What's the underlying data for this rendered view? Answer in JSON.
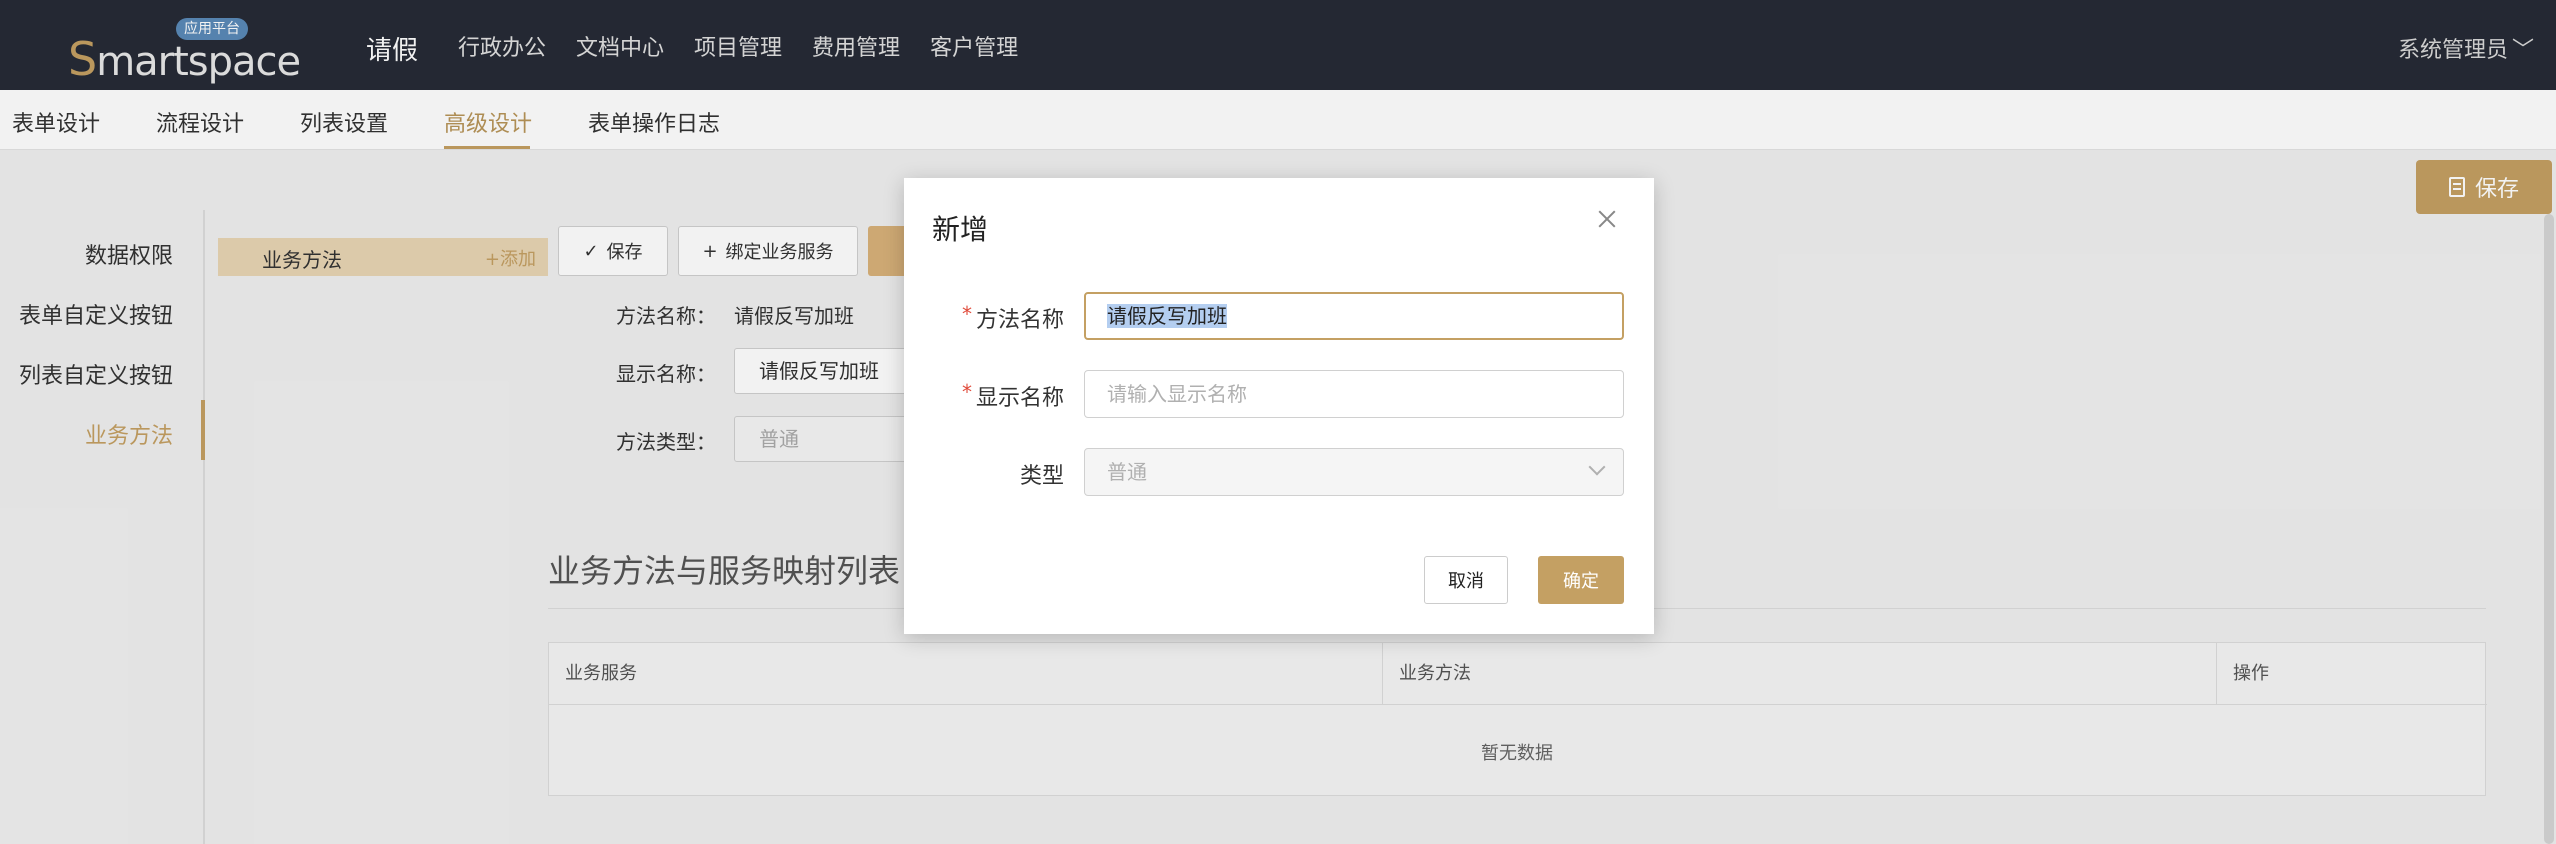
{
  "header": {
    "logo_text_s": "S",
    "logo_text_rest": "martspace",
    "logo_badge": "应用平台",
    "app_title": "请假",
    "nav": [
      "行政办公",
      "文档中心",
      "项目管理",
      "费用管理",
      "客户管理"
    ],
    "user": "系统管理员"
  },
  "tabs": [
    "表单设计",
    "流程设计",
    "列表设置",
    "高级设计",
    "表单操作日志"
  ],
  "active_tab": "高级设计",
  "save_button": "保存",
  "sidebar": {
    "items": [
      "数据权限",
      "表单自定义按钮",
      "列表自定义按钮",
      "业务方法"
    ],
    "active": "业务方法"
  },
  "method_list": {
    "item_name": "业务方法",
    "add_label": "+添加"
  },
  "toolbar": {
    "save_label": "保存",
    "bind_label": "绑定业务服务"
  },
  "form": {
    "method_name_label": "方法名称：",
    "method_name_value": "请假反写加班",
    "display_name_label": "显示名称：",
    "display_name_value": "请假反写加班",
    "method_type_label": "方法类型：",
    "method_type_value": "普通"
  },
  "section": {
    "title": "业务方法与服务映射列表",
    "columns": [
      "业务服务",
      "业务方法",
      "操作"
    ],
    "empty_text": "暂无数据"
  },
  "modal": {
    "title": "新增",
    "fields": [
      {
        "label": "方法名称",
        "required": true,
        "value": "请假反写加班",
        "placeholder": ""
      },
      {
        "label": "显示名称",
        "required": true,
        "value": "",
        "placeholder": "请输入显示名称"
      },
      {
        "label": "类型",
        "required": false,
        "value": "普通",
        "placeholder": ""
      }
    ],
    "required_mark": "*",
    "cancel_label": "取消",
    "ok_label": "确定"
  },
  "colors": {
    "accent": "#c4a063",
    "topbar": "#262b36",
    "method_row_bg": "#e8d5b4"
  }
}
